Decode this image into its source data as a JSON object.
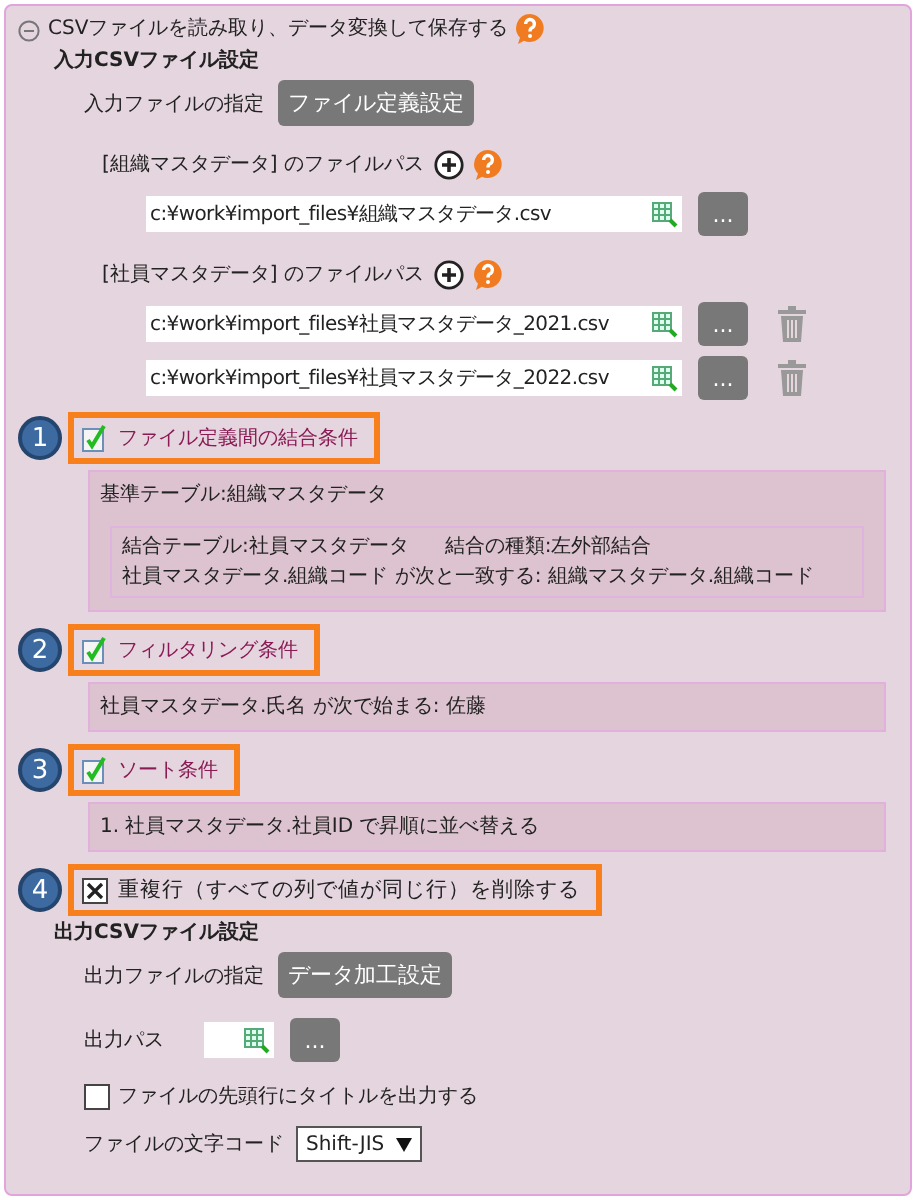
{
  "section": {
    "title": "CSVファイルを読み取り、データ変換して保存する",
    "expanded": true
  },
  "input_settings": {
    "heading": "入力CSVファイル設定",
    "spec_label": "入力ファイルの指定",
    "spec_button": "ファイル定義設定",
    "files": [
      {
        "label": "[組織マスタデータ] のファイルパス",
        "paths": [
          {
            "value": "c:¥work¥import_files¥組織マスタデータ.csv",
            "browse": "...",
            "deletable": false
          }
        ]
      },
      {
        "label": "[社員マスタデータ] のファイルパス",
        "paths": [
          {
            "value": "c:¥work¥import_files¥社員マスタデータ_2021.csv",
            "browse": "...",
            "deletable": true
          },
          {
            "value": "c:¥work¥import_files¥社員マスタデータ_2022.csv",
            "browse": "...",
            "deletable": true
          }
        ]
      }
    ]
  },
  "steps": [
    {
      "number": "1",
      "kind": "link",
      "label": "ファイル定義間の結合条件",
      "details": {
        "base": "基準テーブル:組織マスタデータ",
        "joins": [
          {
            "table": "結合テーブル:社員マスタデータ",
            "type": "結合の種類:左外部結合",
            "condition": "社員マスタデータ.組織コード が次と一致する: 組織マスタデータ.組織コード"
          }
        ]
      }
    },
    {
      "number": "2",
      "kind": "link",
      "label": "フィルタリング条件",
      "details": {
        "lines": [
          "社員マスタデータ.氏名 が次で始まる: 佐藤"
        ]
      }
    },
    {
      "number": "3",
      "kind": "link",
      "label": "ソート条件",
      "details": {
        "lines": [
          "1. 社員マスタデータ.社員ID で昇順に並べ替える"
        ]
      }
    },
    {
      "number": "4",
      "kind": "checkbox",
      "label": "重複行（すべての列で値が同じ行）を削除する",
      "checked": true
    }
  ],
  "output_settings": {
    "heading": "出力CSVファイル設定",
    "spec_label": "出力ファイルの指定",
    "spec_button": "データ加工設定",
    "path_label": "出力パス",
    "browse": "...",
    "title_row": {
      "label": "ファイルの先頭行にタイトルを出力する",
      "checked": false
    },
    "encoding": {
      "label": "ファイルの文字コード",
      "value": "Shift-JIS"
    }
  }
}
